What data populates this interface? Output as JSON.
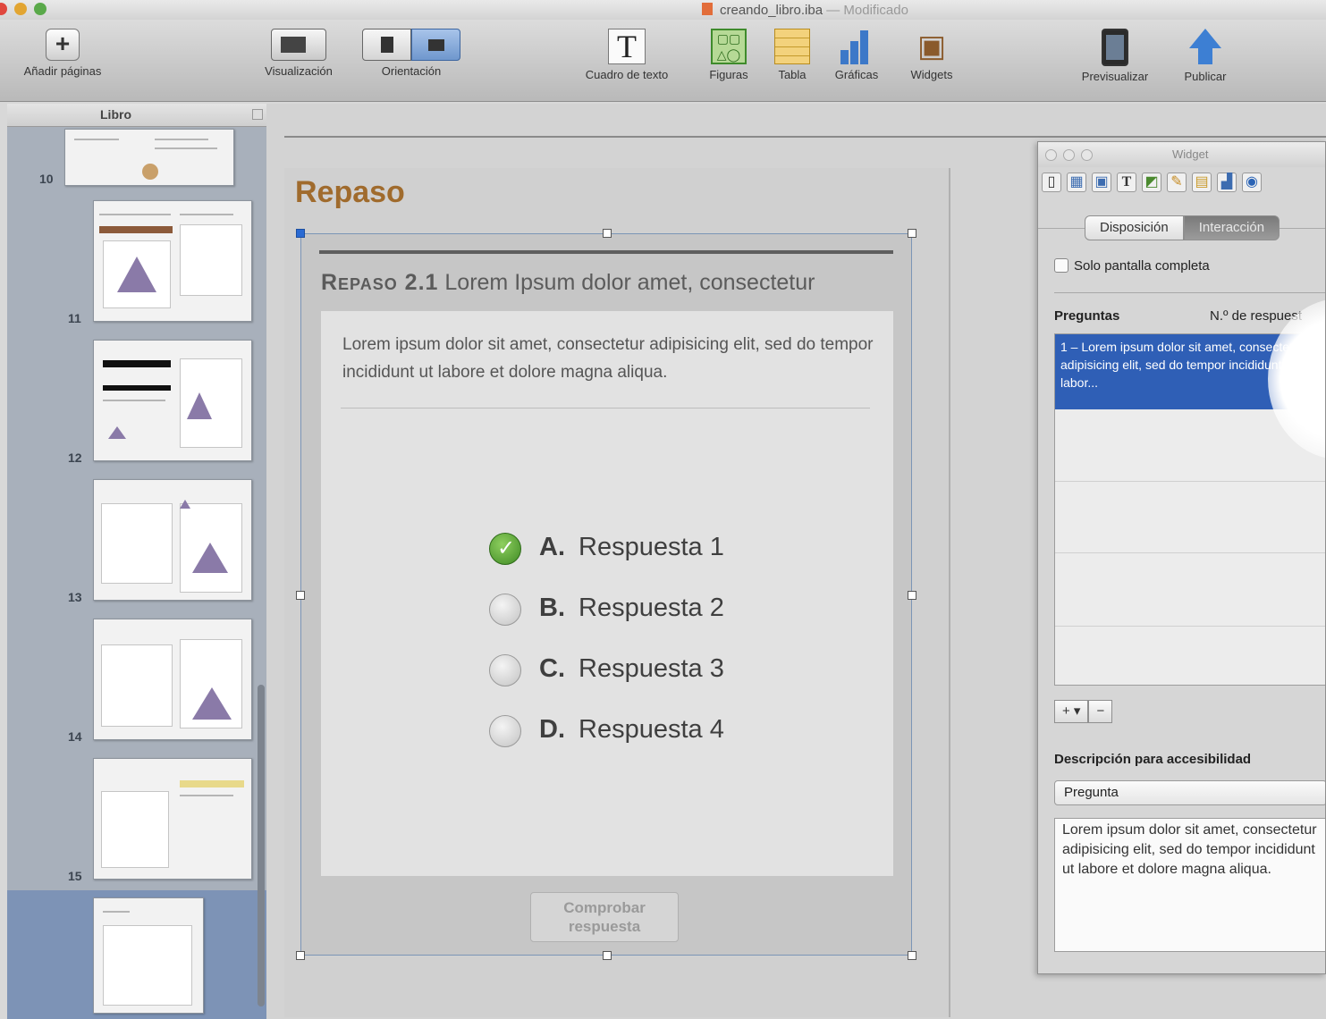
{
  "window": {
    "title": "creando_libro.iba",
    "modified": "— Modificado"
  },
  "toolbar": {
    "items": [
      {
        "label": "Añadir páginas",
        "icon": "add-page-icon"
      },
      {
        "label": "Visualización",
        "icon": "view-icon"
      },
      {
        "label": "Orientación",
        "icon": "orientation-icon"
      },
      {
        "label": "Cuadro de texto",
        "icon": "text-box-icon"
      },
      {
        "label": "Figuras",
        "icon": "shapes-icon"
      },
      {
        "label": "Tabla",
        "icon": "table-icon"
      },
      {
        "label": "Gráficas",
        "icon": "chart-icon"
      },
      {
        "label": "Widgets",
        "icon": "widgets-icon"
      },
      {
        "label": "Previsualizar",
        "icon": "preview-icon"
      },
      {
        "label": "Publicar",
        "icon": "publish-icon"
      }
    ]
  },
  "sidebar": {
    "header": "Libro",
    "pages": [
      "10",
      "11",
      "12",
      "13",
      "14",
      "15"
    ]
  },
  "page": {
    "title": "Repaso"
  },
  "widget": {
    "heading_prefix": "Repaso 2.1",
    "heading_text": "Lorem Ipsum dolor amet, consectetur",
    "question": "Lorem ipsum dolor sit amet, consectetur adipisicing elit, sed do tempor incididunt ut labore et dolore magna aliqua.",
    "answers": [
      {
        "letter": "A.",
        "text": "Respuesta 1",
        "checked": true
      },
      {
        "letter": "B.",
        "text": "Respuesta 2",
        "checked": false
      },
      {
        "letter": "C.",
        "text": "Respuesta 3",
        "checked": false
      },
      {
        "letter": "D.",
        "text": "Respuesta 4",
        "checked": false
      }
    ],
    "check_button": "Comprobar respuesta"
  },
  "inspector": {
    "title": "Widget",
    "tab_layout": "Disposición",
    "tab_interaction": "Interacción",
    "fullscreen_label": "Solo pantalla completa",
    "questions_header": "Preguntas",
    "answers_header": "N.º de respuest",
    "selected_question": "1 – Lorem ipsum dolor sit amet, consectetur adipisicing elit, sed do tempor incididunt ut labor...",
    "add_label": "+ ▾",
    "remove_label": "−",
    "accessibility_label": "Descripción para accesibilidad",
    "popup_value": "Pregunta",
    "description_text": "Lorem ipsum dolor sit amet, consectetur adipisicing elit, sed do tempor incididunt ut labore et dolore magna aliqua."
  }
}
